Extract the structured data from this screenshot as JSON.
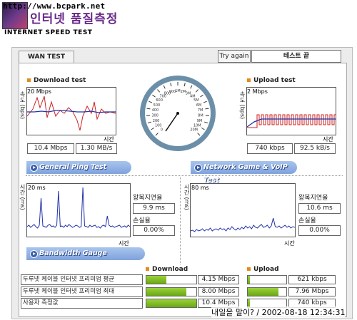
{
  "header": {
    "url": "http://www.bcpark.net",
    "title_kr": "인터넷 품질측정",
    "title_en": "INTERNET SPEED TEST"
  },
  "toolbar": {
    "tab_label": "WAN TEST",
    "try_again_label": "Try again",
    "status_text": "테스트 끝"
  },
  "download": {
    "label": "Download test",
    "y_axis_label": "속도 (bps)",
    "scale_label": "20 Mbps",
    "x_axis_label": "시간",
    "value_mbps": "10.4 Mbps",
    "value_mbs": "1.30 MB/s",
    "colors": {
      "series1": "#cc2222",
      "series2": "#2233aa"
    }
  },
  "upload": {
    "label": "Upload test",
    "y_axis_label": "속도 (bps)",
    "scale_label": "2 Mbps",
    "x_axis_label": "시간",
    "value_kbps": "740 kbps",
    "value_kbs": "92.5 kB/s"
  },
  "gauge": {
    "ticks": [
      "0",
      "100",
      "200",
      "300",
      "400",
      "500",
      "600",
      "700",
      "800",
      "900",
      "1M",
      "2M",
      "3M",
      "4M",
      "5M",
      "6M",
      "7M",
      "8M",
      "9M",
      "10M",
      "20M"
    ],
    "needle_value": "10M"
  },
  "ping": {
    "banner": "General Ping Test",
    "y_axis_label": "시간 (ms)",
    "scale_label": "20 ms",
    "x_axis_label": "시간",
    "rtt_label": "왕복지연율",
    "rtt_value": "9.9 ms",
    "loss_label": "손실율",
    "loss_value": "0.00%"
  },
  "game": {
    "banner": "Network Game & VoIP Test",
    "y_axis_label": "시간 (ms)",
    "scale_label": "80 ms",
    "x_axis_label": "시간",
    "rtt_label": "왕복지연율",
    "rtt_value": "10.6 ms",
    "loss_label": "손실율",
    "loss_value": "0.00%"
  },
  "bandwidth": {
    "banner": "Bandwidth Gauge",
    "download_header": "Download",
    "upload_header": "Upload",
    "rows": [
      {
        "label": "두루넷 케이블 인터넷 프리미엄 평균",
        "download": "4.15 Mbps",
        "download_fill": 0.4,
        "upload": "621 kbps",
        "upload_fill": 0.05
      },
      {
        "label": "두루넷 케이블 인터넷 프리미엄 최대",
        "download": "8.00 Mbps",
        "download_fill": 0.8,
        "upload": "7.96 Mbps",
        "upload_fill": 0.8
      },
      {
        "label": "사용자 측정값",
        "download": "10.4 Mbps",
        "download_fill": 1.0,
        "upload": "740 kbps",
        "upload_fill": 0.06
      }
    ]
  },
  "timestamp": "내일을 말이? / 2002-08-18 12:34:31"
}
